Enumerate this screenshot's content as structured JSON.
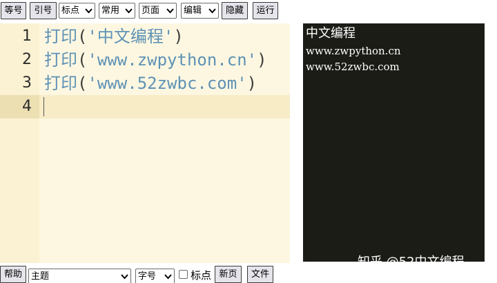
{
  "toolbar": {
    "equals_btn": "等号",
    "quote_btn": "引号",
    "punct_select": "标点",
    "common_select": "常用",
    "page_select": "页面",
    "edit_select": "编辑",
    "hide_btn": "隐藏",
    "run_btn": "运行"
  },
  "editor": {
    "line_numbers": [
      "1",
      "2",
      "3",
      "4"
    ],
    "lines": [
      {
        "func": "打印",
        "open": "(",
        "str": "'中文编程'",
        "close": ")"
      },
      {
        "func": "打印",
        "open": "(",
        "str": "'www.zwpython.cn'",
        "close": ")"
      },
      {
        "func": "打印",
        "open": "(",
        "str": "'www.52zwbc.com'",
        "close": ")"
      }
    ]
  },
  "console": {
    "output": [
      "中文编程",
      "www.zwpython.cn",
      "www.52zwbc.com"
    ],
    "watermark": "知乎 @52中文编程"
  },
  "bottombar": {
    "help_btn": "帮助",
    "theme_select": "主题",
    "fontsize_select": "字号",
    "emoji_label": "标点",
    "newpage_btn": "新页",
    "file_btn": "文件"
  },
  "colors": {
    "editor_bg": "#fdf7e1",
    "gutter_bg": "#fbf2d3",
    "active_line": "#f7ecc6",
    "code_text": "#5e92b5",
    "console_bg": "#1c1c17"
  }
}
